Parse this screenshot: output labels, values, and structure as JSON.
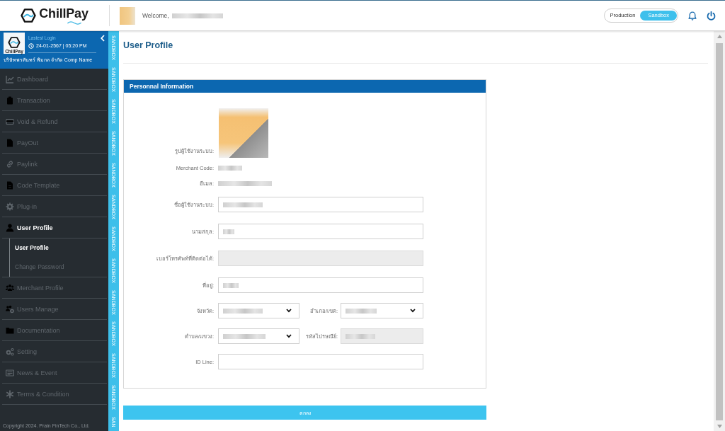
{
  "header": {
    "logo_text": "ChillPay",
    "welcome": "Welcome,",
    "name_redacted": true,
    "environment_toggle": [
      {
        "label": "Production",
        "selected": false
      },
      {
        "label": "Sandbox",
        "selected": true
      }
    ]
  },
  "sidebar": {
    "logo_text": "ChillPay",
    "login_label": "Lastest Login",
    "login_time": "24-01-2567 | 05:20 PM",
    "company": "บริษัทพรสันทร์ พิมกล จำกัด Comp Name",
    "items": [
      {
        "label": "Dashboard",
        "selected": false
      },
      {
        "label": "Transaction",
        "selected": false
      },
      {
        "label": "Void & Refund",
        "selected": false
      },
      {
        "label": "PayOut",
        "selected": false
      },
      {
        "label": "Paylink",
        "selected": false
      },
      {
        "label": "Code Template",
        "selected": false
      },
      {
        "label": "Plug-in",
        "selected": false
      },
      {
        "label": "User Profile",
        "selected": true,
        "children": [
          {
            "label": "User Profile",
            "selected": true
          },
          {
            "label": "Change Password",
            "selected": false
          }
        ]
      },
      {
        "label": "Merchant Profile",
        "selected": false
      },
      {
        "label": "Users Manage",
        "selected": false
      },
      {
        "label": "Documentation",
        "selected": false
      },
      {
        "label": "Setting",
        "selected": false
      },
      {
        "label": "News & Event",
        "selected": false
      },
      {
        "label": "Terms & Condition",
        "selected": false
      }
    ],
    "copyright": "Copyright 2024. Prain FinTech Co., Ltd."
  },
  "sandbox_stripe": [
    "SANDBOX",
    "SANDBOX",
    "SANDBOX",
    "SANDBOX",
    "SANDBOX",
    "SANDBOX",
    "SANDBOX",
    "SANDBOX",
    "SANDBOX",
    "SANDBOX",
    "SANDBOX",
    "SANDBOX",
    "SAN"
  ],
  "page": {
    "title": "User Profile"
  },
  "card": {
    "title": "Personnal Information",
    "rows": [
      {
        "fields": [
          {
            "kind": "image",
            "label": "รูปผู้ใช้งานระบบ:"
          }
        ]
      },
      {
        "fields": [
          {
            "kind": "static",
            "label": "Merchant Code:",
            "redacted": true
          }
        ]
      },
      {
        "fields": [
          {
            "kind": "static",
            "label": "อีเมล:",
            "redacted": true
          }
        ]
      },
      {
        "fields": [
          {
            "kind": "text",
            "label": "ชื่อผู้ใช้งานระบบ:",
            "disabled": false,
            "redacted": true
          }
        ]
      },
      {
        "fields": [
          {
            "kind": "text",
            "label": "นามสกุล:",
            "disabled": false,
            "redacted": true
          }
        ]
      },
      {
        "fields": [
          {
            "kind": "text",
            "label": "เบอร์โทรศัพท์ที่ติดต่อได้:",
            "disabled": true,
            "redacted": false
          }
        ]
      },
      {
        "fields": [
          {
            "kind": "text",
            "label": "ที่อยู่:",
            "disabled": false,
            "redacted": true
          }
        ]
      },
      {
        "fields": [
          {
            "kind": "select",
            "label": "จังหวัด:",
            "redacted": true
          },
          {
            "kind": "select",
            "label": "อำเภอ/เขต:",
            "redacted": true
          }
        ]
      },
      {
        "fields": [
          {
            "kind": "select",
            "label": "ตำบล/แขวง:",
            "redacted": true
          },
          {
            "kind": "text",
            "label": "รหัสไปรษณีย์:",
            "disabled": true,
            "redacted": true
          }
        ]
      },
      {
        "fields": [
          {
            "kind": "text",
            "label": "ID Line:",
            "disabled": false,
            "redacted": false
          }
        ]
      }
    ]
  },
  "submit_button": "ตกลง"
}
